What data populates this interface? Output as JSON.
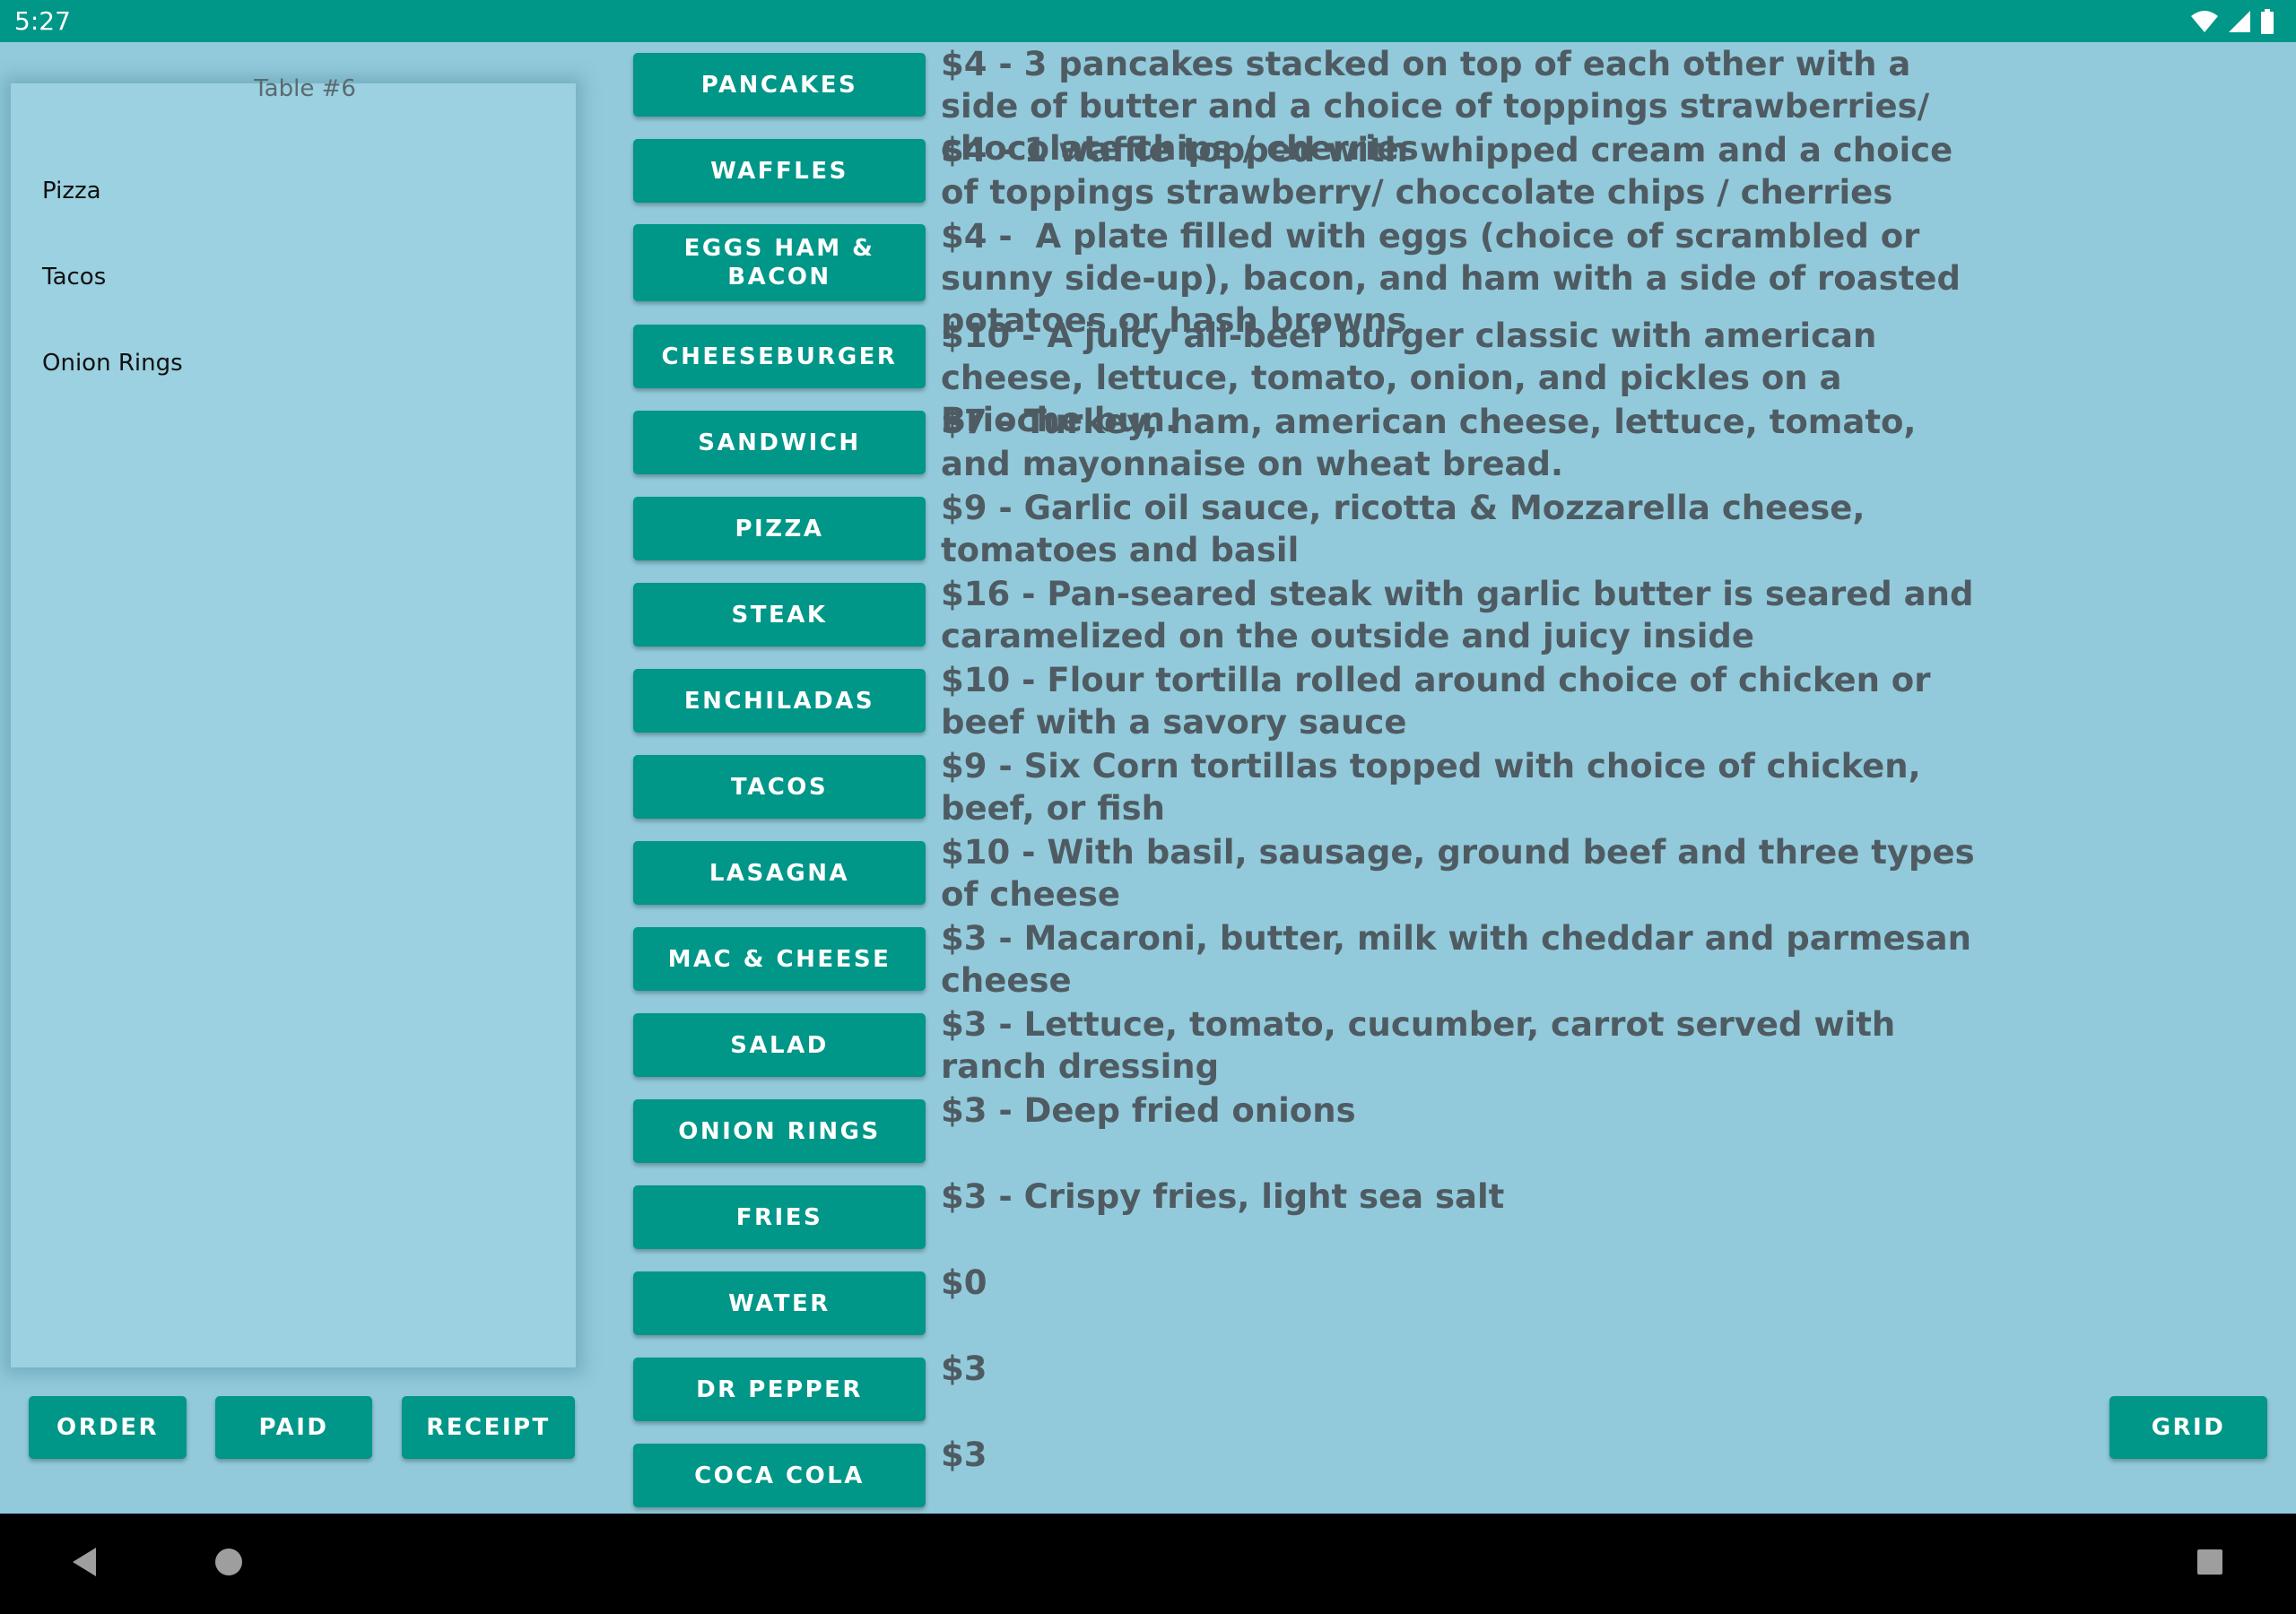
{
  "status_bar": {
    "time": "5:27",
    "icons": [
      "wifi-icon",
      "cell-signal-icon",
      "battery-icon"
    ]
  },
  "order_panel": {
    "table_label": "Table #6",
    "items": [
      "Pizza",
      "Tacos",
      "Onion Rings"
    ]
  },
  "actions": {
    "order": "ORDER",
    "paid": "PAID",
    "receipt": "RECEIPT",
    "grid": "GRID"
  },
  "menu": [
    {
      "label": "PANCAKES",
      "description": "$4 - 3 pancakes stacked on top of each other with a side of butter and a choice of toppings strawberries/ chocolate chips / cherries"
    },
    {
      "label": "WAFFLES",
      "description": "$4 - 1 waffle topped with whipped cream and a choice of toppings strawberry/ choccolate chips / cherries"
    },
    {
      "label": "EGGS HAM & BACON",
      "description": "$4 -  A plate filled with eggs (choice of scrambled or sunny side-up), bacon, and ham with a side of roasted potatoes or hash browns"
    },
    {
      "label": "CHEESEBURGER",
      "description": "$10 - A juicy all-beef burger classic with american cheese, lettuce, tomato, onion, and pickles on a Brioche bun."
    },
    {
      "label": "SANDWICH",
      "description": "$7 - Turkey, ham, american cheese, lettuce, tomato, and mayonnaise on wheat bread."
    },
    {
      "label": "PIZZA",
      "description": "$9 - Garlic oil sauce, ricotta & Mozzarella cheese, tomatoes and basil"
    },
    {
      "label": "STEAK",
      "description": "$16 - Pan-seared steak with garlic butter is seared and caramelized on the outside and juicy inside"
    },
    {
      "label": "ENCHILADAS",
      "description": "$10 - Flour tortilla rolled around choice of chicken or beef with a savory sauce"
    },
    {
      "label": "TACOS",
      "description": "$9 - Six Corn tortillas topped with choice of chicken, beef, or fish"
    },
    {
      "label": "LASAGNA",
      "description": "$10 - With basil, sausage, ground beef and three types of cheese"
    },
    {
      "label": "MAC & CHEESE",
      "description": "$3 - Macaroni, butter, milk with cheddar and parmesan cheese"
    },
    {
      "label": "SALAD",
      "description": "$3 - Lettuce, tomato, cucumber, carrot served with ranch dressing"
    },
    {
      "label": "ONION RINGS",
      "description": "$3 - Deep fried onions"
    },
    {
      "label": "FRIES",
      "description": "$3 - Crispy fries, light sea salt"
    },
    {
      "label": "WATER",
      "description": "$0"
    },
    {
      "label": "DR PEPPER",
      "description": "$3"
    },
    {
      "label": "COCA COLA",
      "description": "$3"
    }
  ],
  "nav_bar": {
    "icons": [
      "back-icon",
      "home-icon",
      "recents-icon"
    ]
  },
  "colors": {
    "accent": "#009688",
    "background": "#92cadb",
    "panel": "#9bd1e1",
    "description_text": "#4f5b62"
  }
}
